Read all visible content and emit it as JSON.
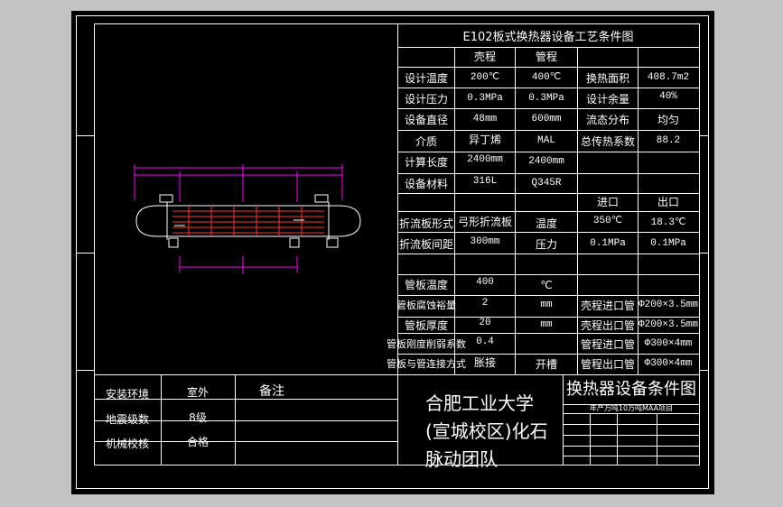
{
  "colors": {
    "background": "#c3c3c3",
    "sheet": "#000000",
    "line": "#ffffff",
    "drawing": "#ff00ff",
    "accent": "#ff3333"
  },
  "table": {
    "title": "E102板式换热器设备工艺条件图",
    "header": {
      "col1": "壳程",
      "col2": "管程"
    },
    "rows": [
      {
        "label": "设计温度",
        "shell": "200℃",
        "tube": "400℃",
        "label2": "换热面积",
        "value2": "408.7m2"
      },
      {
        "label": "设计压力",
        "shell": "0.3MPa",
        "tube": "0.3MPa",
        "label2": "设计余量",
        "value2": "40%"
      },
      {
        "label": "设备直径",
        "shell": "48mm",
        "tube": "600mm",
        "label2": "流态分布",
        "value2": "均匀"
      },
      {
        "label": "介质",
        "shell": "异丁烯",
        "tube": "MAL",
        "label2": "总传热系数",
        "value2": "88.2"
      },
      {
        "label": "计算长度",
        "shell": "2400mm",
        "tube": "2400mm"
      },
      {
        "label": "设备材料",
        "shell": "316L",
        "tube": "Q345R"
      }
    ],
    "inout": {
      "in": "进口",
      "out": "出口"
    },
    "rows2": [
      {
        "label": "折流板形式",
        "value": "弓形折流板",
        "label2": "温度",
        "in": "350℃",
        "out": "18.3℃"
      },
      {
        "label": "折流板间距",
        "value": "300mm",
        "label2": "压力",
        "in": "0.1MPa",
        "out": "0.1MPa"
      }
    ],
    "rows3": [
      {
        "label": "管板温度",
        "value": "400",
        "unit": "℃"
      },
      {
        "label": "管板腐蚀裕量",
        "value": "2",
        "unit": "mm",
        "label2": "壳程进口管",
        "value2": "Φ200×3.5mm"
      },
      {
        "label": "管板厚度",
        "value": "20",
        "unit": "mm",
        "label2": "壳程出口管",
        "value2": "Φ200×3.5mm"
      },
      {
        "label": "管板刚度削弱系数",
        "value": "0.4",
        "unit": "",
        "label2": "管程进口管",
        "value2": "Φ300×4mm"
      },
      {
        "label": "管板与管连接方式",
        "value": "胀接",
        "unit": "开槽",
        "label2": "管程出口管",
        "value2": "Φ300×4mm"
      }
    ]
  },
  "env": {
    "rows": [
      {
        "label": "安装环境",
        "value": "室外"
      },
      {
        "label": "地震级数",
        "value": "8级"
      },
      {
        "label": "机械校核",
        "value": "合格"
      }
    ],
    "note": "备注"
  },
  "title_block": {
    "school": "合肥工业大学(宣城校区)化石脉动团队",
    "drawing_title": "换热器设备条件图",
    "project": "年产万吨10万吨MAA项目"
  }
}
